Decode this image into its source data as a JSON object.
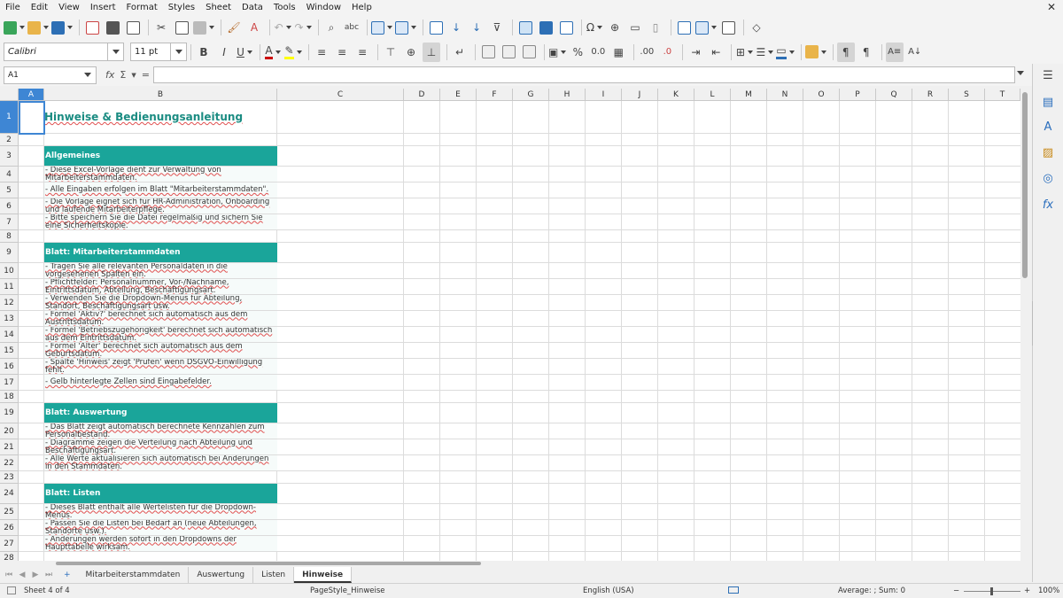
{
  "menu": [
    "File",
    "Edit",
    "View",
    "Insert",
    "Format",
    "Styles",
    "Sheet",
    "Data",
    "Tools",
    "Window",
    "Help"
  ],
  "font": {
    "name": "Calibri",
    "size": "11 pt"
  },
  "namebox": "A1",
  "formula": {
    "fx_label": "fx",
    "sigma_label": "Σ",
    "equals_label": "="
  },
  "columns": [
    "A",
    "B",
    "C",
    "D",
    "E",
    "F",
    "G",
    "H",
    "I",
    "J",
    "K",
    "L",
    "M",
    "N",
    "O",
    "P",
    "Q",
    "R",
    "S",
    "T"
  ],
  "rows": [
    {
      "n": "1",
      "type": "title",
      "text": "Hinweise & Bedienungsanleitung"
    },
    {
      "n": "2",
      "type": "empty",
      "text": ""
    },
    {
      "n": "3",
      "type": "section",
      "text": "Allgemeines"
    },
    {
      "n": "4",
      "type": "body",
      "text": "- Diese Excel-Vorlage dient zur Verwaltung von Mitarbeiterstammdaten."
    },
    {
      "n": "5",
      "type": "body",
      "text": "- Alle Eingaben erfolgen im Blatt \"Mitarbeiterstammdaten\"."
    },
    {
      "n": "6",
      "type": "body",
      "text": "- Die Vorlage eignet sich für HR-Administration, Onboarding und laufende Mitarbeiterpflege."
    },
    {
      "n": "7",
      "type": "body",
      "text": "- Bitte speichern Sie die Datei regelmäßig und sichern Sie eine Sicherheitskopie."
    },
    {
      "n": "8",
      "type": "empty",
      "text": ""
    },
    {
      "n": "9",
      "type": "section",
      "text": "Blatt: Mitarbeiterstammdaten"
    },
    {
      "n": "10",
      "type": "body",
      "text": "- Tragen Sie alle relevanten Personaldaten in die vorgesehenen Spalten ein."
    },
    {
      "n": "11",
      "type": "body",
      "text": "- Pflichtfelder: Personalnummer, Vor-/Nachname, Eintrittsdatum, Abteilung, Beschäftigungsart."
    },
    {
      "n": "12",
      "type": "body",
      "text": "- Verwenden Sie die Dropdown-Menüs für Abteilung, Standort, Beschäftigungsart usw."
    },
    {
      "n": "13",
      "type": "body",
      "text": "- Formel 'Aktiv?' berechnet sich automatisch aus dem Austrittsdatum."
    },
    {
      "n": "14",
      "type": "body",
      "text": "- Formel 'Betriebszugehörigkeit' berechnet sich automatisch aus dem Eintrittsdatum."
    },
    {
      "n": "15",
      "type": "body",
      "text": "- Formel 'Alter' berechnet sich automatisch aus dem Geburtsdatum."
    },
    {
      "n": "16",
      "type": "body",
      "text": "- Spalte 'Hinweis' zeigt 'Prüfen' wenn DSGVO-Einwilligung fehlt."
    },
    {
      "n": "17",
      "type": "body",
      "text": "- Gelb hinterlegte Zellen sind Eingabefelder."
    },
    {
      "n": "18",
      "type": "empty",
      "text": ""
    },
    {
      "n": "19",
      "type": "section",
      "text": "Blatt: Auswertung"
    },
    {
      "n": "20",
      "type": "body",
      "text": "- Das Blatt zeigt automatisch berechnete Kennzahlen zum Personalbestand."
    },
    {
      "n": "21",
      "type": "body",
      "text": "- Diagramme zeigen die Verteilung nach Abteilung und Beschäftigungsart."
    },
    {
      "n": "22",
      "type": "body",
      "text": "- Alle Werte aktualisieren sich automatisch bei Änderungen in den Stammdaten."
    },
    {
      "n": "23",
      "type": "empty",
      "text": ""
    },
    {
      "n": "24",
      "type": "section",
      "text": "Blatt: Listen"
    },
    {
      "n": "25",
      "type": "body",
      "text": "- Dieses Blatt enthält alle Wertelisten für die Dropdown-Menüs."
    },
    {
      "n": "26",
      "type": "body",
      "text": "- Passen Sie die Listen bei Bedarf an (neue Abteilungen, Standorte usw.)."
    },
    {
      "n": "27",
      "type": "body",
      "text": "- Änderungen werden sofort in den Dropdowns der Haupttabelle wirksam."
    },
    {
      "n": "28",
      "type": "empty",
      "text": ""
    }
  ],
  "tabs": [
    "Mitarbeiterstammdaten",
    "Auswertung",
    "Listen",
    "Hinweise"
  ],
  "active_tab": "Hinweise",
  "status": {
    "sheet": "Sheet 4 of 4",
    "pagestyle": "PageStyle_Hinweise",
    "language": "English (USA)",
    "sum": "Average: ; Sum: 0",
    "zoom": "100%",
    "zoom_minus": "−",
    "zoom_plus": "+"
  },
  "colors": {
    "accent": "#1aa59a",
    "title": "#1b8c82",
    "selection": "#3e86d4"
  }
}
